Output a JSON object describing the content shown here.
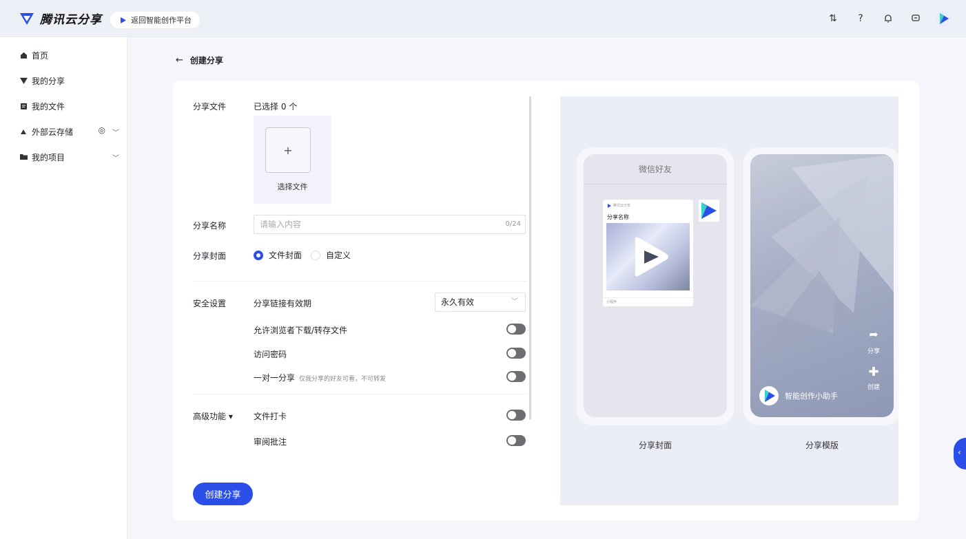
{
  "header": {
    "brand": "腾讯云分享",
    "back_platform": "返回智能创作平台",
    "icons": [
      "transfer-icon",
      "help-icon",
      "bell-icon",
      "message-icon",
      "avatar-icon"
    ],
    "accent_color": "#2b4ee8"
  },
  "sidebar": {
    "items": [
      {
        "label": "首页",
        "icon": "home-icon"
      },
      {
        "label": "我的分享",
        "icon": "share-icon"
      },
      {
        "label": "我的文件",
        "icon": "file-icon"
      },
      {
        "label": "外部云存储",
        "icon": "cloud-icon"
      },
      {
        "label": "我的项目",
        "icon": "folder-icon"
      }
    ]
  },
  "page": {
    "back_label": "创建分享"
  },
  "form": {
    "files_label": "分享文件",
    "selected_count": "已选择 0 个",
    "select_file": "选择文件",
    "name_label": "分享名称",
    "name_placeholder": "请输入内容",
    "name_counter": "0/24",
    "cover_label": "分享封面",
    "cover_options": [
      "文件封面",
      "自定义"
    ],
    "security_label": "安全设置",
    "expiry_label": "分享链接有效期",
    "expiry_value": "永久有效",
    "allow_download": "允许浏览者下载/转存文件",
    "password": "访问密码",
    "one_to_one": "一对一分享",
    "one_to_one_hint": "仅我分享的好友可看，不可转发",
    "advanced_label": "高级功能 ▾",
    "checkin": "文件打卡",
    "review": "审阅批注",
    "create_button": "创建分享"
  },
  "preview": {
    "wechat_title": "微信好友",
    "mini_brand": "腾讯云分享",
    "mini_name": "分享名称",
    "mini_footer": "小程序",
    "share_action": "分享",
    "create_action": "创建",
    "assistant": "智能创作小助手",
    "cover_caption": "分享封面",
    "template_caption": "分享模版"
  }
}
